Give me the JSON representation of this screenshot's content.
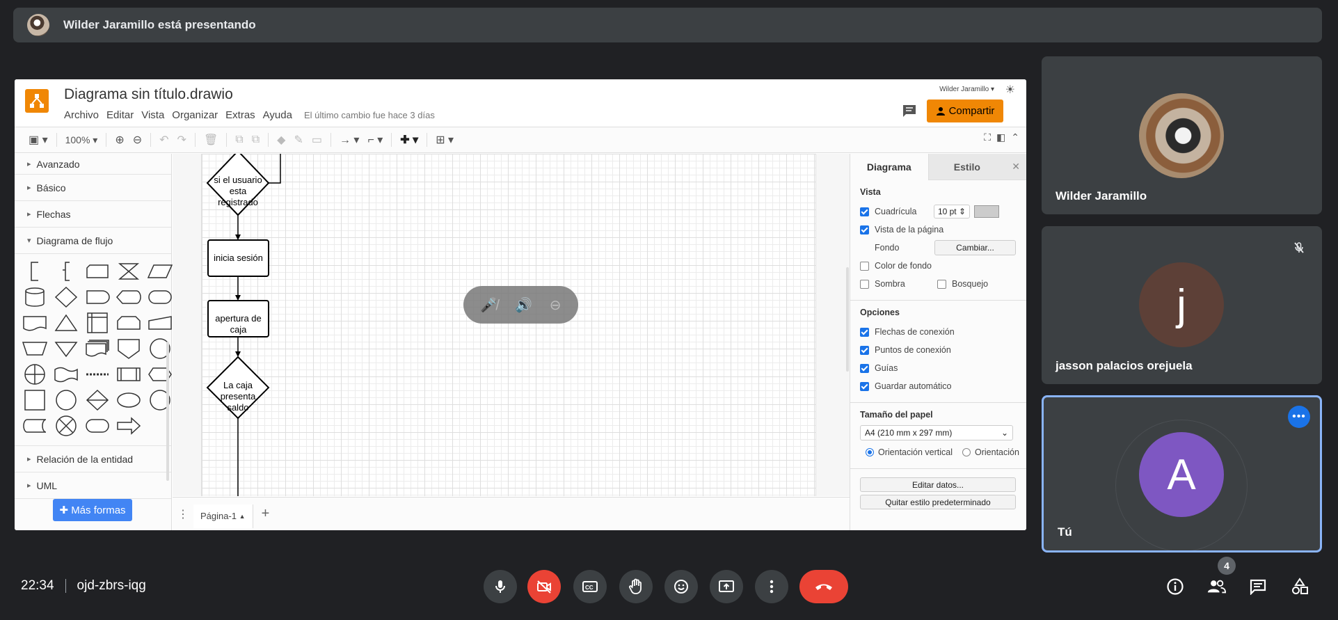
{
  "presenter_bar": {
    "text": "Wilder Jaramillo está presentando"
  },
  "drawio": {
    "title": "Diagrama sin título.drawio",
    "menu": [
      "Archivo",
      "Editar",
      "Vista",
      "Organizar",
      "Extras",
      "Ayuda"
    ],
    "last_change": "El último cambio fue hace 3 días",
    "user": "Wilder Jaramillo",
    "share_label": "Compartir",
    "zoom": "100%",
    "left_sections": {
      "advanced": "Avanzado",
      "basic": "Básico",
      "arrows": "Flechas",
      "flowchart": "Diagrama de flujo",
      "entity_relation": "Relación de la entidad",
      "uml": "UML"
    },
    "more_shapes": "Más formas",
    "nodes": {
      "n1": "si el usuario esta registrado",
      "n2": "inicia sesión",
      "n3": "apertura de caja",
      "n4": "La caja presenta saldo"
    },
    "page_tab": "Página-1",
    "format": {
      "tab_diagram": "Diagrama",
      "tab_style": "Estilo",
      "view_header": "Vista",
      "grid": "Cuadrícula",
      "grid_size": "10 pt",
      "page_view": "Vista de la página",
      "background": "Fondo",
      "change": "Cambiar...",
      "bg_color": "Color de fondo",
      "shadow": "Sombra",
      "sketch": "Bosquejo",
      "options_header": "Opciones",
      "connection_arrows": "Flechas de conexión",
      "connection_points": "Puntos de conexión",
      "guides": "Guías",
      "autosave": "Guardar automático",
      "paper_header": "Tamaño del papel",
      "paper_size": "A4 (210 mm x 297 mm)",
      "portrait": "Orientación vertical",
      "landscape": "Orientación",
      "edit_data": "Editar datos...",
      "clear_style": "Quitar estilo predeterminado"
    }
  },
  "participants": [
    {
      "name": "Wilder Jaramillo",
      "avatar": "photo"
    },
    {
      "name": "jasson palacios orejuela",
      "initial": "j",
      "color": "#5d4037",
      "muted": true
    },
    {
      "name": "Tú",
      "initial": "A",
      "color": "#7e57c2"
    }
  ],
  "meeting": {
    "time": "22:34",
    "code": "ojd-zbrs-iqg",
    "participants_count": "4"
  },
  "colors": {
    "accent": "#8ab4f8",
    "end_call": "#ea4335",
    "drawio_orange": "#f08705"
  }
}
